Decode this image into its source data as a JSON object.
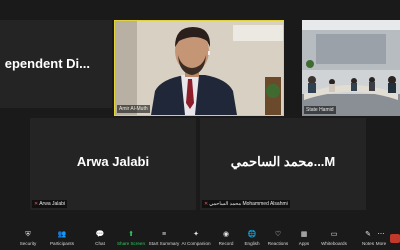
{
  "tiles": {
    "left_top": {
      "display_name": "ependent  Di..."
    },
    "center_top": {
      "tag_name": "Amir Al-Muth"
    },
    "right_top": {
      "tag_name": "State Hamid"
    },
    "left_bottom": {
      "display_name": "Arwa Jalabi",
      "tag_name": "Arwa Jalabi"
    },
    "right_bottom": {
      "display_name": "محمد الساحمي...M",
      "tag_name": "محمد الساحمي Mohammed Alsahmi"
    }
  },
  "toolbar": {
    "items": [
      {
        "label": "Security",
        "icon": "shield-icon"
      },
      {
        "label": "Participants",
        "icon": "people-icon"
      },
      {
        "label": "Chat",
        "icon": "chat-icon"
      },
      {
        "label": "Share Screen",
        "icon": "share-screen-icon"
      },
      {
        "label": "Start Summary",
        "icon": "summary-icon"
      },
      {
        "label": "AI Companion",
        "icon": "ai-companion-icon"
      },
      {
        "label": "Record",
        "icon": "record-icon"
      },
      {
        "label": "English",
        "icon": "globe-icon"
      },
      {
        "label": "Reactions",
        "icon": "heart-icon"
      },
      {
        "label": "Apps",
        "icon": "apps-icon"
      },
      {
        "label": "Whiteboards",
        "icon": "whiteboard-icon"
      },
      {
        "label": "Notes",
        "icon": "notes-icon"
      },
      {
        "label": "More",
        "icon": "more-icon"
      }
    ]
  },
  "colors": {
    "share_green": "#2ecc5a",
    "active_speaker_border": "#e3d33a",
    "leave_red": "#c0392b"
  }
}
